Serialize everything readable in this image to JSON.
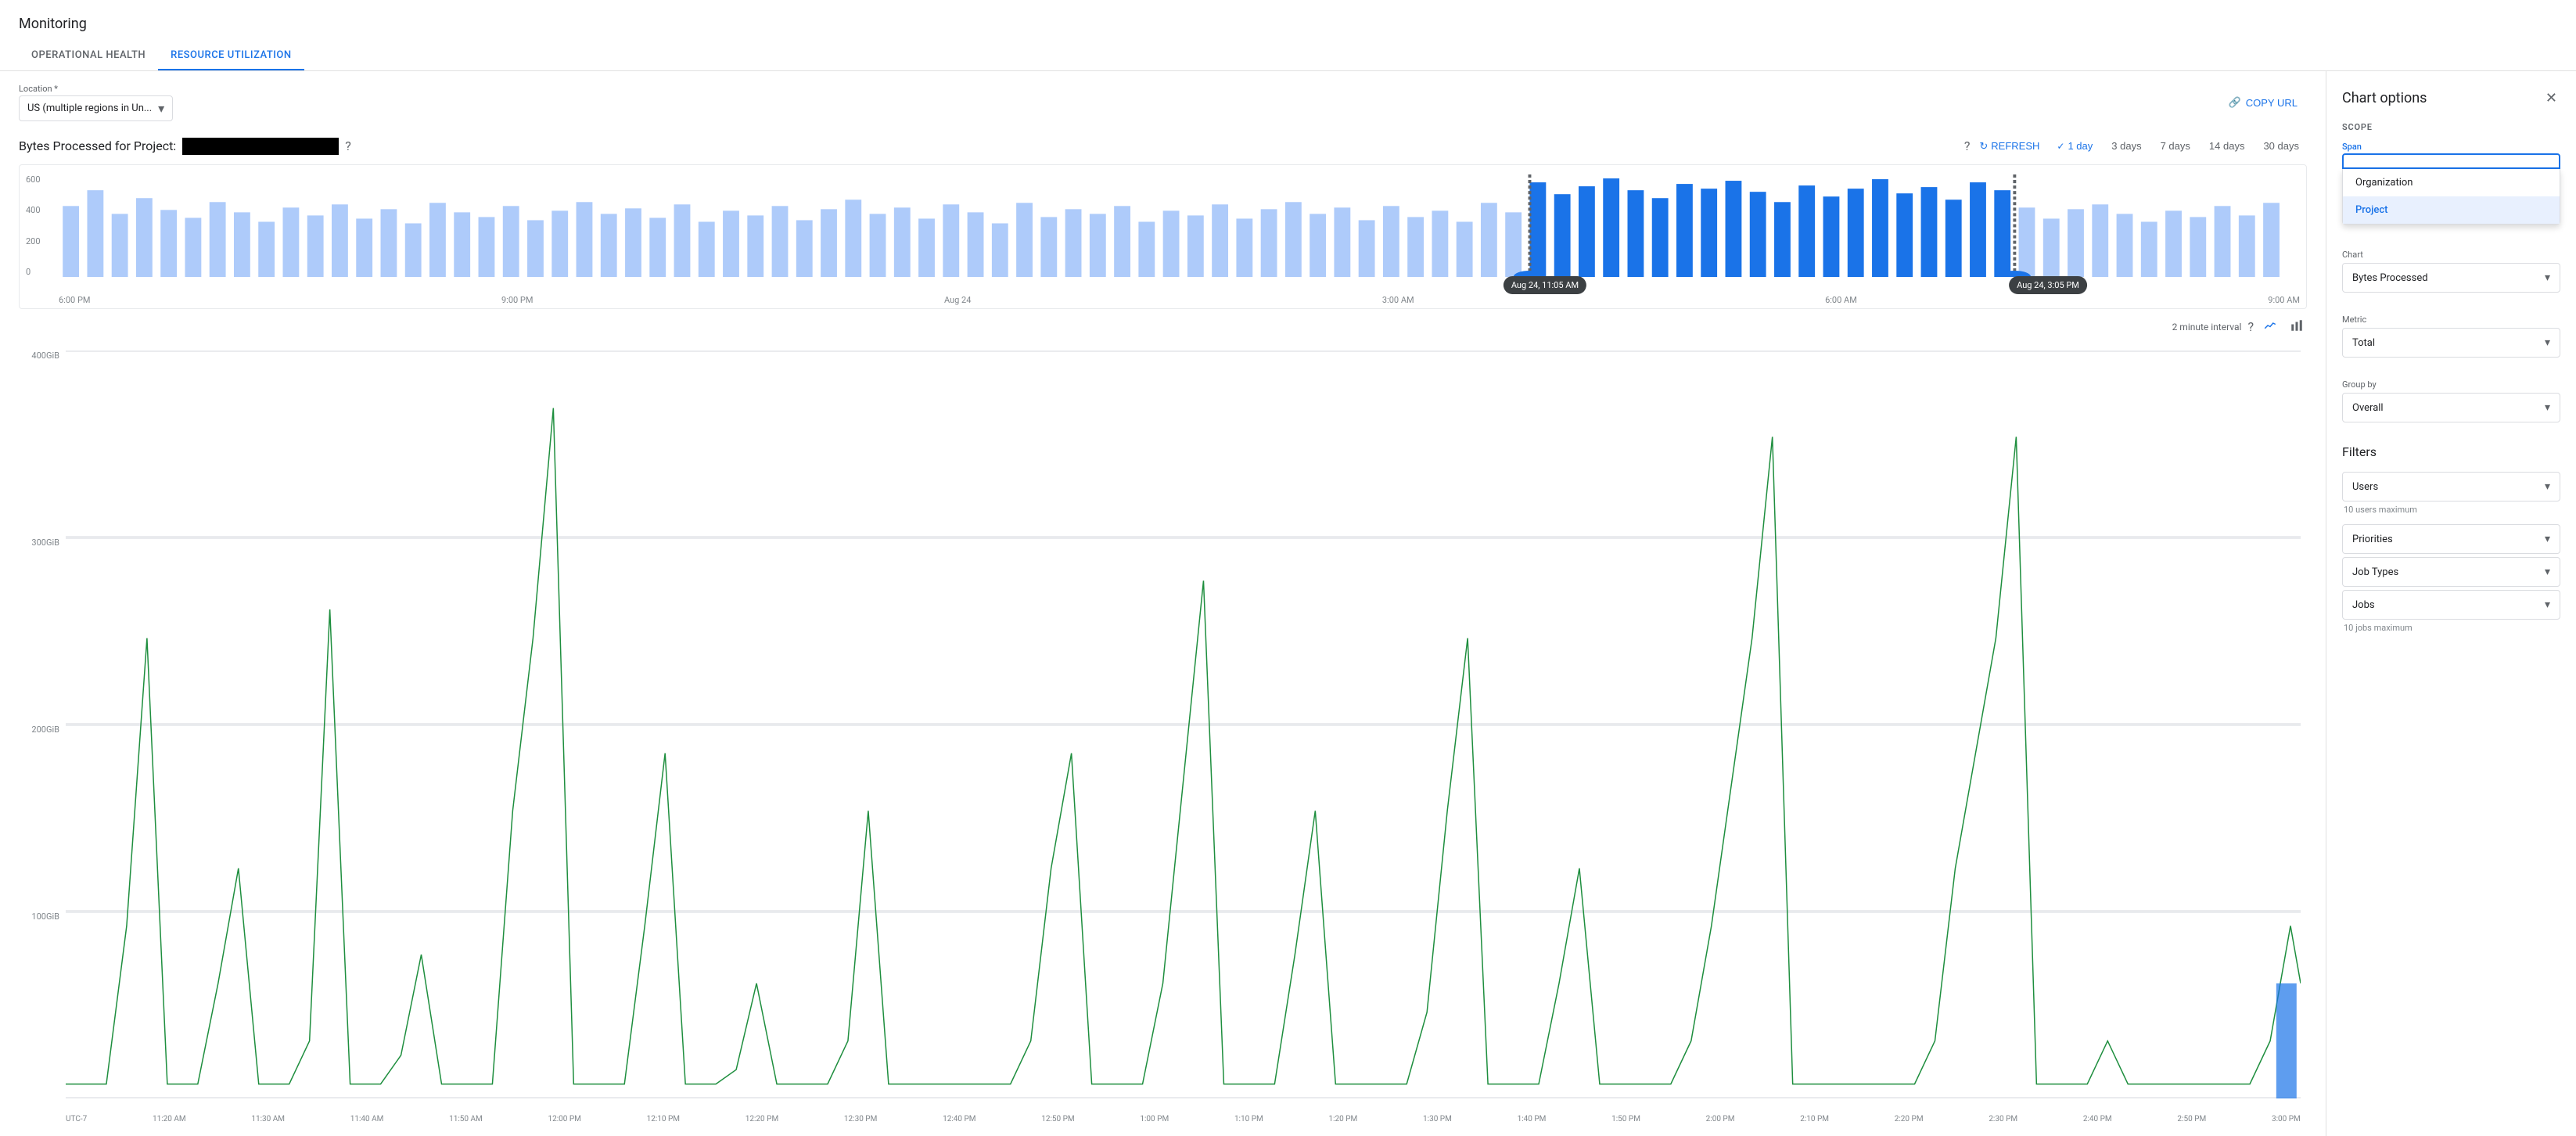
{
  "app": {
    "title": "Monitoring"
  },
  "tabs": [
    {
      "id": "operational-health",
      "label": "OPERATIONAL HEALTH",
      "active": false
    },
    {
      "id": "resource-utilization",
      "label": "RESOURCE UTILIZATION",
      "active": true
    }
  ],
  "location": {
    "label": "Location *",
    "value": "US (multiple regions in Un...",
    "chevron": "▾"
  },
  "copy_url": {
    "label": "COPY URL",
    "icon": "🔗"
  },
  "section": {
    "title_prefix": "Bytes Processed for Project:",
    "title_redacted": true,
    "help": "?"
  },
  "controls": {
    "refresh_label": "REFRESH",
    "time_options": [
      {
        "label": "1 day",
        "active": true
      },
      {
        "label": "3 days",
        "active": false
      },
      {
        "label": "7 days",
        "active": false
      },
      {
        "label": "14 days",
        "active": false
      },
      {
        "label": "30 days",
        "active": false
      }
    ]
  },
  "overview_chart": {
    "y_labels": [
      "600",
      "400",
      "200",
      "0"
    ],
    "x_labels": [
      "6:00 PM",
      "9:00 PM",
      "Aug 24",
      "3:00 AM",
      "6:00 AM",
      "9:00 AM"
    ],
    "tooltip_left": "Aug 24, 11:05 AM",
    "tooltip_right": "Aug 24, 3:05 PM"
  },
  "interval": {
    "label": "2 minute interval",
    "help": "?",
    "icons": [
      "line",
      "bar"
    ]
  },
  "detail_chart": {
    "y_labels": [
      "400GiB",
      "300GiB",
      "200GiB",
      "100GiB",
      ""
    ],
    "x_labels": [
      "UTC-7",
      "11:20 AM",
      "11:30 AM",
      "11:40 AM",
      "11:50 AM",
      "12:00 PM",
      "12:10 PM",
      "12:20 PM",
      "12:30 PM",
      "12:40 PM",
      "12:50 PM",
      "1:00 PM",
      "1:10 PM",
      "1:20 PM",
      "1:30 PM",
      "1:40 PM",
      "1:50 PM",
      "2:00 PM",
      "2:10 PM",
      "2:20 PM",
      "2:30 PM",
      "2:40 PM",
      "2:50 PM",
      "3:00 PM"
    ]
  },
  "chart_options_panel": {
    "title": "Chart options",
    "close_icon": "✕",
    "scope": {
      "title": "Scope",
      "span_label": "Span",
      "span_options": [
        {
          "label": "Organization",
          "selected": false
        },
        {
          "label": "Project",
          "selected": true
        }
      ]
    },
    "chart_section": {
      "title": "Chart",
      "dropdown_label": "Chart",
      "dropdown_value": "Bytes Processed"
    },
    "metric_section": {
      "dropdown_label": "Metric",
      "dropdown_value": "Total"
    },
    "group_by_section": {
      "dropdown_label": "Group by",
      "dropdown_value": "Overall"
    },
    "filters": {
      "title": "Filters",
      "items": [
        {
          "label": "Users",
          "hint": "10 users maximum"
        },
        {
          "label": "Priorities",
          "hint": ""
        },
        {
          "label": "Job Types",
          "hint": ""
        },
        {
          "label": "Jobs",
          "hint": "10 jobs maximum"
        }
      ]
    }
  }
}
